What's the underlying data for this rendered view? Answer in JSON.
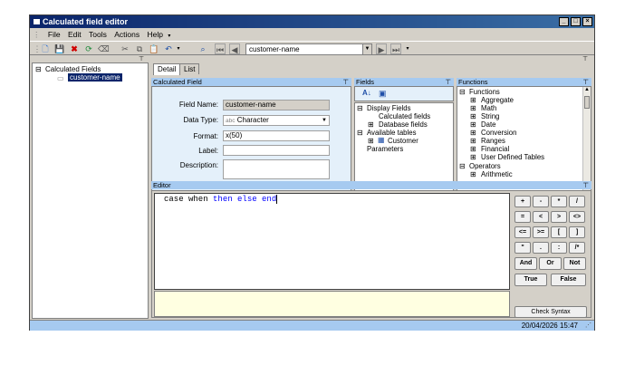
{
  "window": {
    "title": "Calculated field editor"
  },
  "menu": [
    "File",
    "Edit",
    "Tools",
    "Actions",
    "Help"
  ],
  "toolbar": {
    "current_field": "customer-name"
  },
  "tree": {
    "root": "Calculated Fields",
    "selected": "customer-name"
  },
  "tabs": [
    "Detail",
    "List"
  ],
  "detail": {
    "header": "Calculated Field",
    "field_name_label": "Field Name:",
    "field_name": "customer-name",
    "data_type_label": "Data Type:",
    "data_type_prefix": "abc",
    "data_type": "Character",
    "format_label": "Format:",
    "format": "x(50)",
    "label_label": "Label:",
    "label": "",
    "description_label": "Description:",
    "description": ""
  },
  "fields": {
    "header": "Fields",
    "items": [
      "Display Fields",
      "Calculated fields",
      "Database fields",
      "Available tables",
      "Customer",
      "Parameters"
    ]
  },
  "functions": {
    "header": "Functions",
    "items": [
      "Functions",
      "Aggregate",
      "Math",
      "String",
      "Date",
      "Conversion",
      "Ranges",
      "Financial",
      "User Defined Tables",
      "Operators",
      "Arithmetic"
    ]
  },
  "editor": {
    "header": "Editor",
    "tokens": [
      {
        "text": "case when ",
        "color": "#000000"
      },
      {
        "text": "then else end",
        "color": "#0000ff"
      }
    ]
  },
  "keypad": {
    "rows": [
      [
        "+",
        "-",
        "*",
        "/"
      ],
      [
        "=",
        "<",
        ">",
        "<>"
      ],
      [
        "<=",
        ">=",
        "[",
        "]"
      ],
      [
        "\"",
        ".",
        ":",
        "/*"
      ]
    ],
    "logic": [
      "And",
      "Or",
      "Not"
    ],
    "bool": [
      "True",
      "False"
    ]
  },
  "check_syntax": "Check Syntax",
  "status": {
    "timestamp": "20/04/2026  15:47"
  },
  "colors": {
    "title": "#0a246a",
    "panel_header": "#a6caf0",
    "keyword": "#0000ff",
    "tip_area": "#ffffe1"
  }
}
